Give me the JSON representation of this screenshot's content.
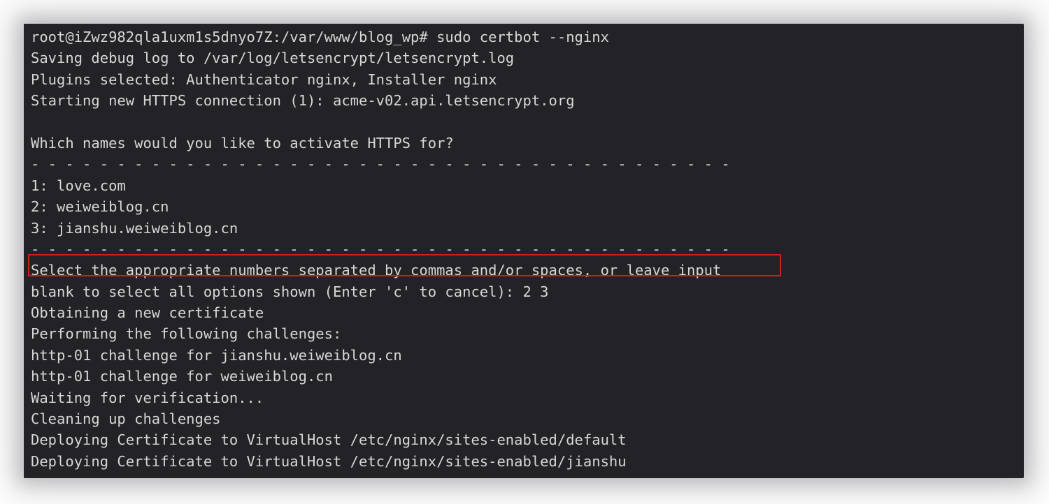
{
  "window": {
    "background_color": "#232327",
    "text_color": "#d6d6d6",
    "page_background_color": "#ffffff"
  },
  "annotation": {
    "type": "rectangle",
    "color": "#cc1f1f",
    "target_line_index": 11,
    "target_text": "Select the appropriate numbers separated by commas and/or spaces, or leave input"
  },
  "terminal": {
    "prompt": {
      "user": "root",
      "host": "iZwz982qla1uxm1s5dnyo7Z",
      "cwd": "/var/www/blog_wp",
      "symbol": "#",
      "command": "sudo certbot --nginx"
    },
    "separator": "- - - - - - - - - - - - - - - - - - - - - - - - - - - - - - - - - - - - - - - - -",
    "domain_choices": [
      {
        "number": "1",
        "domain": "love.com"
      },
      {
        "number": "2",
        "domain": "weiweiblog.cn"
      },
      {
        "number": "3",
        "domain": "jianshu.weiweiblog.cn"
      }
    ],
    "user_input": "2 3",
    "lines": [
      "root@iZwz982qla1uxm1s5dnyo7Z:/var/www/blog_wp# sudo certbot --nginx",
      "Saving debug log to /var/log/letsencrypt/letsencrypt.log",
      "Plugins selected: Authenticator nginx, Installer nginx",
      "Starting new HTTPS connection (1): acme-v02.api.letsencrypt.org",
      "",
      "Which names would you like to activate HTTPS for?",
      "- - - - - - - - - - - - - - - - - - - - - - - - - - - - - - - - - - - - - - - - -",
      "1: love.com",
      "2: weiweiblog.cn",
      "3: jianshu.weiweiblog.cn",
      "- - - - - - - - - - - - - - - - - - - - - - - - - - - - - - - - - - - - - - - - -",
      "Select the appropriate numbers separated by commas and/or spaces, or leave input",
      "blank to select all options shown (Enter 'c' to cancel): 2 3",
      "Obtaining a new certificate",
      "Performing the following challenges:",
      "http-01 challenge for jianshu.weiweiblog.cn",
      "http-01 challenge for weiweiblog.cn",
      "Waiting for verification...",
      "Cleaning up challenges",
      "Deploying Certificate to VirtualHost /etc/nginx/sites-enabled/default",
      "Deploying Certificate to VirtualHost /etc/nginx/sites-enabled/jianshu"
    ]
  }
}
